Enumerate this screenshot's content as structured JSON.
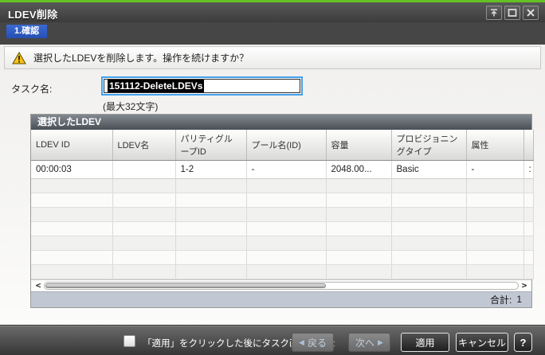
{
  "window": {
    "title": "LDEV削除",
    "controls": {
      "pin_icon": "collapse-to-top",
      "maximize_icon": "maximize",
      "close_icon": "close"
    }
  },
  "steps": {
    "step1": "1.確認"
  },
  "warning": {
    "icon": "warning-triangle",
    "message": "選択したLDEVを削除します。操作を続けますか？"
  },
  "form": {
    "task_label": "タスク名:",
    "task_value": "151112-DeleteLDEVs",
    "task_hint": "(最大32文字)"
  },
  "table": {
    "title": "選択したLDEV",
    "columns": [
      "LDEV ID",
      "LDEV名",
      "パリティグループID",
      "プール名(ID)",
      "容量",
      "プロビジョニングタイプ",
      "属性",
      ""
    ],
    "rows": [
      [
        "00:00:03",
        "",
        "1-2",
        "-",
        "2048.00...",
        "Basic",
        "-",
        ":"
      ]
    ],
    "scrollbar": {
      "left_arrow": "<",
      "right_arrow": ">"
    },
    "total_label": "合計:",
    "total_value": "1"
  },
  "footer": {
    "checkbox_label": "「適用」をクリックした後にタスク画面を表示",
    "back_label": "戻る",
    "back_arrow": "◀",
    "next_label": "次へ",
    "next_arrow": "▶",
    "apply_label": "適用",
    "cancel_label": "キャンセル",
    "help_label": "?"
  },
  "colors": {
    "accent_green": "#63c221",
    "tab_blue": "#2e5cc5",
    "focus_blue": "#44a0ea",
    "total_bar": "#c2c8d3"
  }
}
